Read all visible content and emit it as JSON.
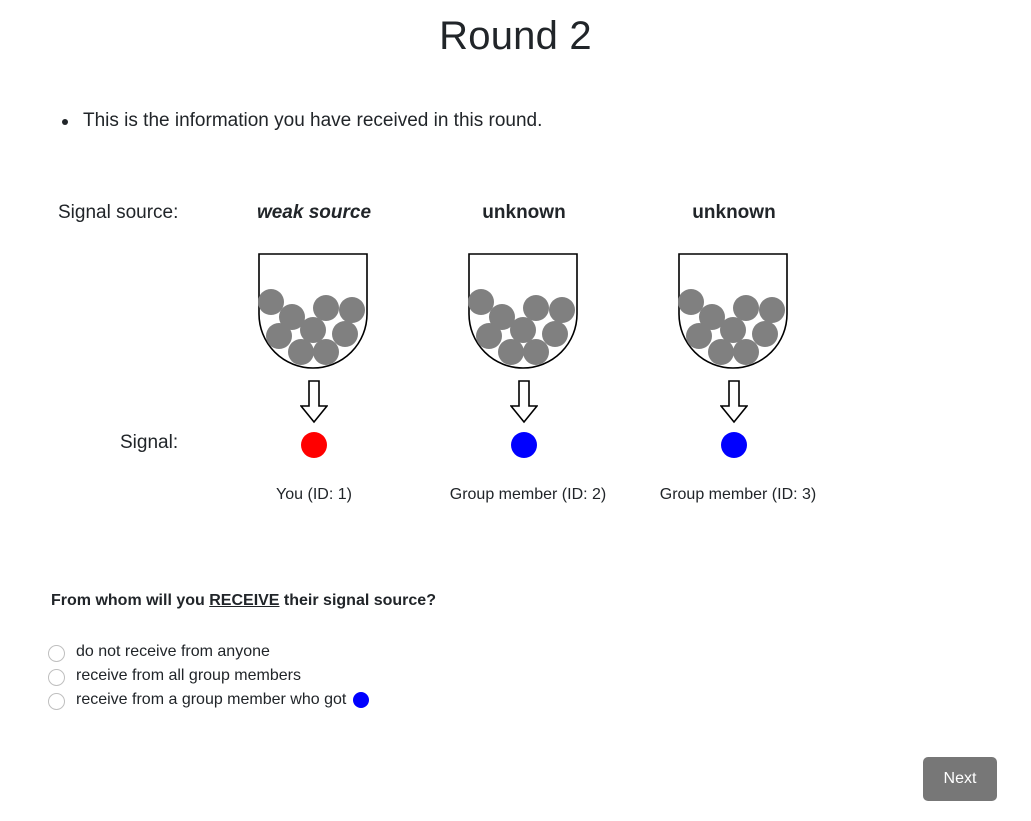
{
  "page": {
    "title": "Round 2",
    "info_text": "This is the information you have received in this round."
  },
  "labels": {
    "signal_source": "Signal source:",
    "signal": "Signal:"
  },
  "sources": [
    {
      "source_label": "weak source",
      "signal_color": "#ff0000",
      "member_label": "You (ID: 1)"
    },
    {
      "source_label": "unknown",
      "signal_color": "#0000ff",
      "member_label": "Group member (ID: 2)"
    },
    {
      "source_label": "unknown",
      "signal_color": "#0000ff",
      "member_label": "Group member (ID: 3)"
    }
  ],
  "urn": {
    "ball_color": "#808080",
    "outline_color": "#000000",
    "ball_count": 10
  },
  "question": {
    "prefix": "From whom will you ",
    "emphasis": "RECEIVE",
    "suffix": " their signal source?"
  },
  "options": [
    {
      "label": "do not receive from anyone",
      "selected": false
    },
    {
      "label": "receive from all group members",
      "selected": false
    },
    {
      "label": "receive from a group member who got",
      "selected": false,
      "dot_color": "#0000ff"
    }
  ],
  "buttons": {
    "next_label": "Next"
  }
}
